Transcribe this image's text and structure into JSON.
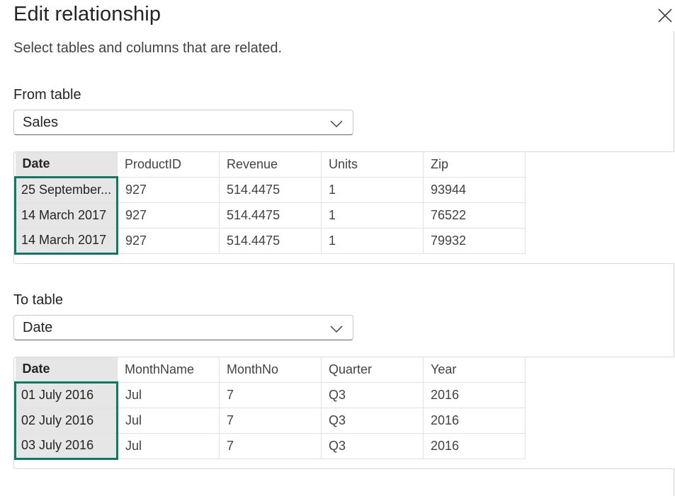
{
  "dialog": {
    "title": "Edit relationship",
    "subtitle": "Select tables and columns that are related."
  },
  "from": {
    "label": "From table",
    "selected_table": "Sales",
    "columns": [
      "Date",
      "ProductID",
      "Revenue",
      "Units",
      "Zip"
    ],
    "selected_column": "Date",
    "rows": [
      [
        "25 September...",
        "927",
        "514.4475",
        "1",
        "93944"
      ],
      [
        "14 March 2017",
        "927",
        "514.4475",
        "1",
        "76522"
      ],
      [
        "14 March 2017",
        "927",
        "514.4475",
        "1",
        "79932"
      ]
    ]
  },
  "to": {
    "label": "To table",
    "selected_table": "Date",
    "columns": [
      "Date",
      "MonthName",
      "MonthNo",
      "Quarter",
      "Year"
    ],
    "selected_column": "Date",
    "rows": [
      [
        "01 July 2016",
        "Jul",
        "7",
        "Q3",
        "2016"
      ],
      [
        "02 July 2016",
        "Jul",
        "7",
        "Q3",
        "2016"
      ],
      [
        "03 July 2016",
        "Jul",
        "7",
        "Q3",
        "2016"
      ]
    ]
  },
  "icons": {
    "close": "close-icon",
    "dropdown": "chevron-down-icon"
  },
  "colors": {
    "selection_border": "#117865",
    "selected_fill": "#e6e6e6"
  }
}
